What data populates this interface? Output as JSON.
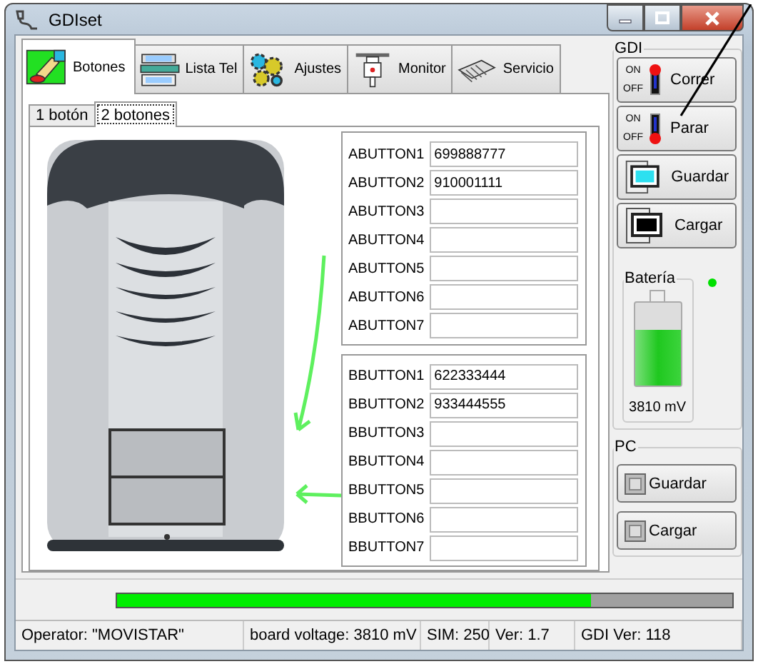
{
  "window": {
    "title": "GDIset"
  },
  "tabs": [
    {
      "label": "Botones",
      "selected": true
    },
    {
      "label": "Lista Tel",
      "selected": false
    },
    {
      "label": "Ajustes",
      "selected": false
    },
    {
      "label": "Monitor",
      "selected": false
    },
    {
      "label": "Servicio",
      "selected": false
    }
  ],
  "subtabs": [
    {
      "label": "1 botón",
      "selected": false
    },
    {
      "label": "2 botones",
      "selected": true
    }
  ],
  "groups": [
    {
      "fields": [
        {
          "label": "ABUTTON1",
          "value": "699888777"
        },
        {
          "label": "ABUTTON2",
          "value": "910001111"
        },
        {
          "label": "ABUTTON3"
        },
        {
          "label": "ABUTTON4"
        },
        {
          "label": "ABUTTON5"
        },
        {
          "label": "ABUTTON6"
        },
        {
          "label": "ABUTTON7"
        }
      ]
    },
    {
      "fields": [
        {
          "label": "BBUTTON1",
          "value": "622333444"
        },
        {
          "label": "BBUTTON2",
          "value": "933444555"
        },
        {
          "label": "BBUTTON3"
        },
        {
          "label": "BBUTTON4"
        },
        {
          "label": "BBUTTON5"
        },
        {
          "label": "BBUTTON6"
        },
        {
          "label": "BBUTTON7"
        }
      ]
    }
  ],
  "gdi_panel": {
    "title": "GDI",
    "buttons": [
      {
        "label": "Correr",
        "kind": "switch-on",
        "on_label": "ON",
        "off_label": "OFF"
      },
      {
        "label": "Parar",
        "kind": "switch-off",
        "on_label": "ON",
        "off_label": "OFF"
      },
      {
        "label": "Guardar",
        "kind": "device-screen"
      },
      {
        "label": "Cargar",
        "kind": "device-dark"
      }
    ],
    "battery": {
      "title": "Batería",
      "level": 0.68,
      "reading": "3810 mV"
    },
    "indicator": {
      "on": true
    }
  },
  "pc_panel": {
    "title": "PC",
    "buttons": [
      {
        "label": "Guardar"
      },
      {
        "label": "Cargar"
      }
    ]
  },
  "progress": {
    "level": 0.77
  },
  "status_bar": [
    "Operator: \"MOVISTAR\"",
    "board voltage: 3810 mV",
    "SIM: 250",
    "Ver: 1.7",
    "GDI Ver: 118"
  ]
}
